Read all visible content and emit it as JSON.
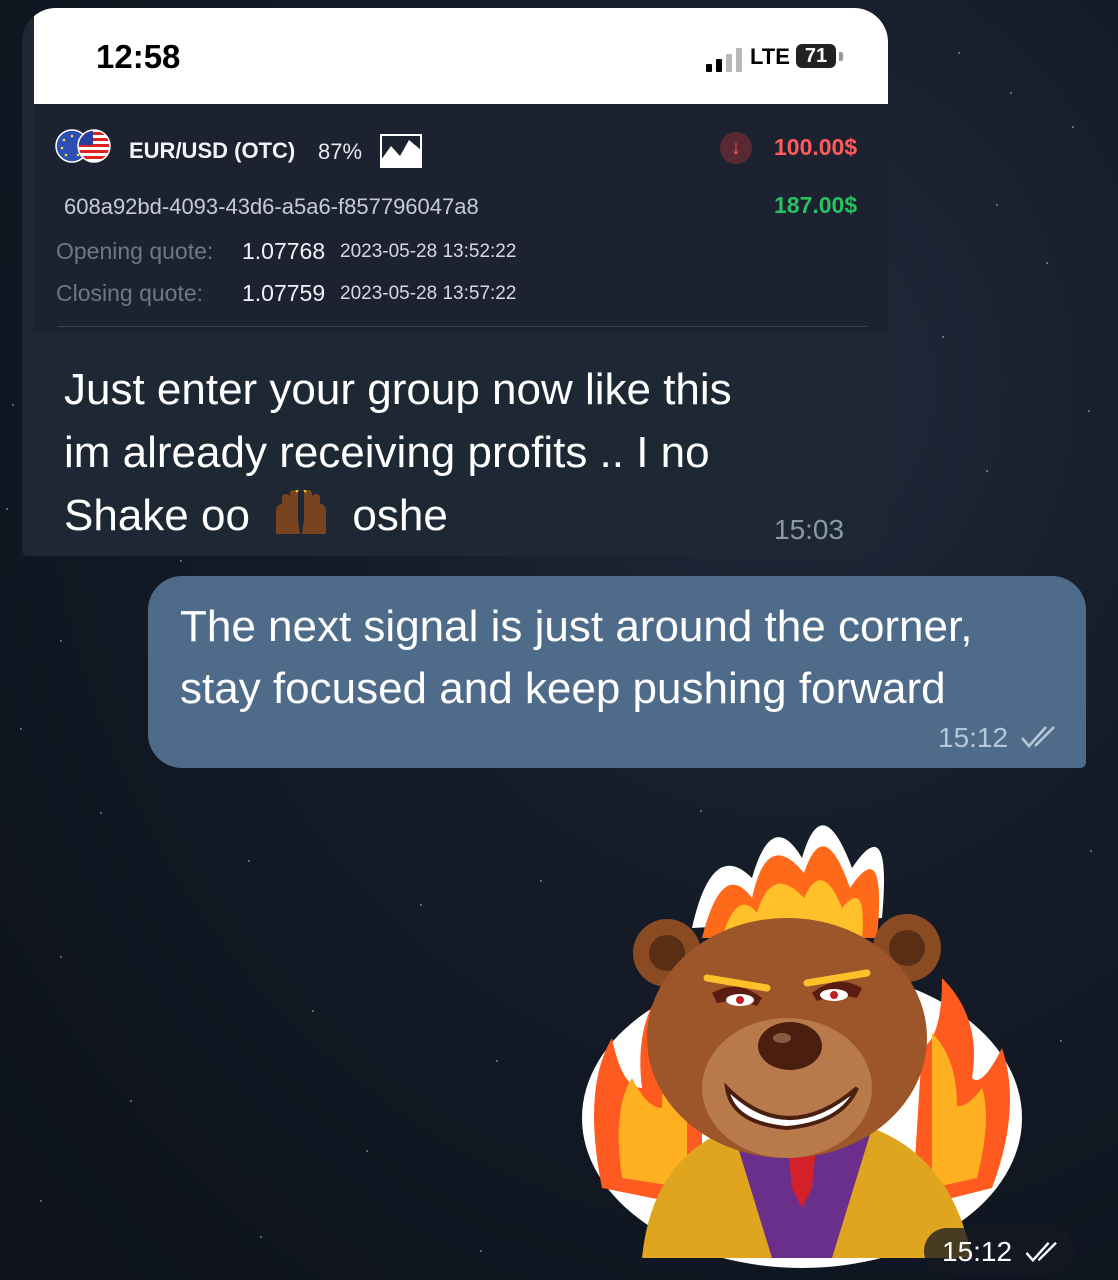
{
  "phone_status": {
    "time": "12:58",
    "network": "LTE",
    "battery": "71"
  },
  "trade_card": {
    "pair": "EUR/USD (OTC)",
    "payout_percent": "87%",
    "trade_id": "608a92bd-4093-43d6-a5a6-f857796047a8",
    "investment": "100.00$",
    "payout": "187.00$",
    "opening_label": "Opening quote:",
    "opening_value": "1.07768",
    "opening_datetime": "2023-05-28 13:52:22",
    "closing_label": "Closing quote:",
    "closing_value": "1.07759",
    "closing_datetime": "2023-05-28 13:57:22",
    "direction_icon": "arrow-down-icon"
  },
  "incoming_message": {
    "line1": "Just enter your group now like this",
    "line2": "im already receiving profits .. I no",
    "line3_start": "Shake oo",
    "line3_end": "oshe",
    "emoji": "raising-hands-emoji",
    "time": "15:03"
  },
  "outgoing_message": {
    "line1": "The next signal is just around the corner,",
    "line2": "stay focused and keep pushing forward",
    "time": "15:12",
    "status_icon": "double-check-icon"
  },
  "sticker_message": {
    "sticker": "flaming-bear-sticker",
    "time": "15:12",
    "status_icon": "double-check-icon"
  },
  "colors": {
    "incoming_bubble": "#1e2834",
    "outgoing_bubble": "#4e6b89",
    "loss_red": "#ff5b5b",
    "profit_green": "#26c160"
  }
}
